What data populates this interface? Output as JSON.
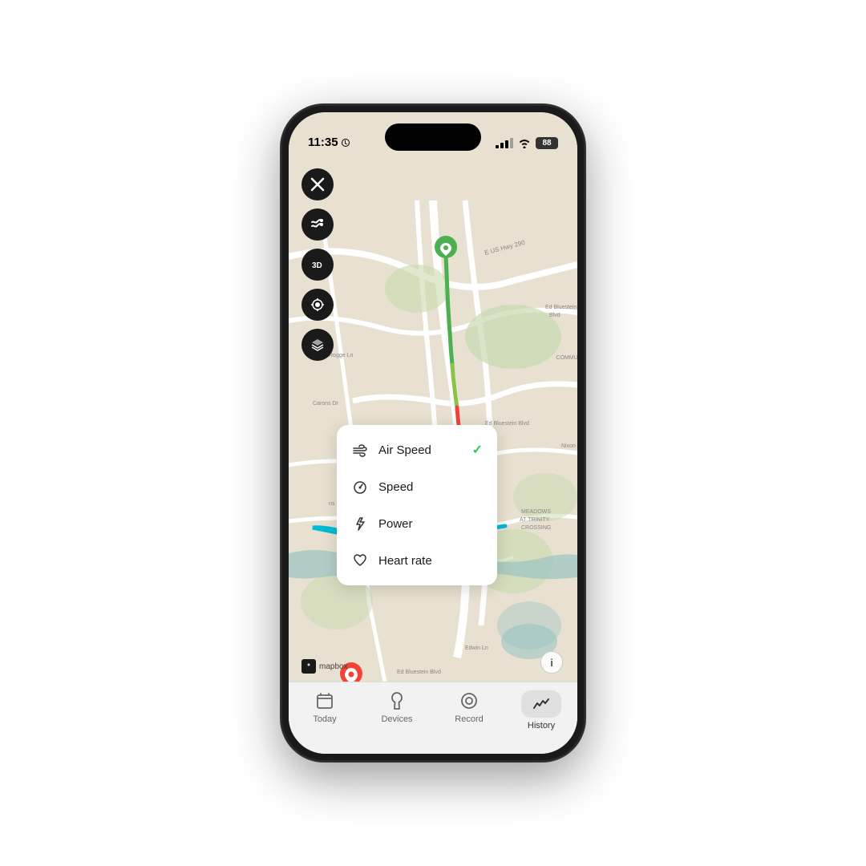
{
  "status_bar": {
    "time": "11:35",
    "battery": "88"
  },
  "toolbar": {
    "buttons": [
      {
        "id": "close",
        "icon": "×",
        "label": "close-button"
      },
      {
        "id": "route-style",
        "label": "route-style-button"
      },
      {
        "id": "3d",
        "label": "3d-button"
      },
      {
        "id": "locate",
        "label": "locate-button"
      },
      {
        "id": "layers",
        "label": "layers-button"
      }
    ]
  },
  "dropdown": {
    "items": [
      {
        "id": "air-speed",
        "label": "Air Speed",
        "checked": true
      },
      {
        "id": "speed",
        "label": "Speed",
        "checked": false
      },
      {
        "id": "power",
        "label": "Power",
        "checked": false
      },
      {
        "id": "heart-rate",
        "label": "Heart rate",
        "checked": false
      }
    ]
  },
  "tab_bar": {
    "tabs": [
      {
        "id": "today",
        "label": "Today",
        "active": false
      },
      {
        "id": "devices",
        "label": "Devices",
        "active": false
      },
      {
        "id": "record",
        "label": "Record",
        "active": false
      },
      {
        "id": "history",
        "label": "History",
        "active": true
      }
    ]
  },
  "map": {
    "mapbox_label": "mapbox",
    "info_label": "i"
  }
}
